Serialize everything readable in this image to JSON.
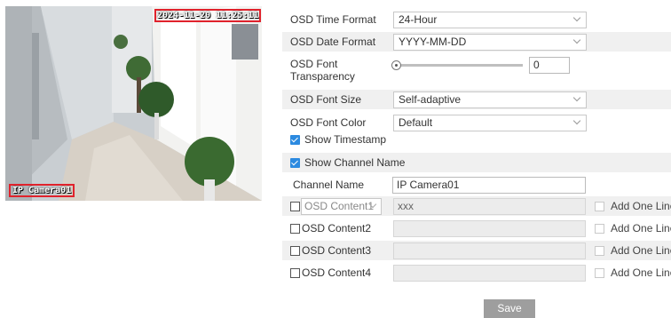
{
  "preview": {
    "osd_time": "2024-11-20 11:25:11",
    "osd_channel_name": "IP Camera01"
  },
  "settings": {
    "time_format_label": "OSD Time Format",
    "time_format_value": "24-Hour",
    "date_format_label": "OSD Date Format",
    "date_format_value": "YYYY-MM-DD",
    "font_transparency_label_line1": "OSD Font",
    "font_transparency_label_line2": "Transparency",
    "font_transparency_value": "0",
    "font_size_label": "OSD Font Size",
    "font_size_value": "Self-adaptive",
    "font_color_label": "OSD Font Color",
    "font_color_value": "Default",
    "show_timestamp_label": "Show Timestamp",
    "show_timestamp_checked": true,
    "show_channel_name_label": "Show Channel Name",
    "show_channel_name_checked": true,
    "channel_name_label": "Channel Name",
    "channel_name_value": "IP Camera01"
  },
  "osd_contents": [
    {
      "label": "OSD Content1",
      "value": "xxx",
      "add_one_line": "Add One Line"
    },
    {
      "label": "OSD Content2",
      "value": "",
      "add_one_line": "Add One Line"
    },
    {
      "label": "OSD Content3",
      "value": "",
      "add_one_line": "Add One Line"
    },
    {
      "label": "OSD Content4",
      "value": "",
      "add_one_line": "Add One Line"
    }
  ],
  "save_label": "Save",
  "colors": {
    "accent": "#2c8ae0",
    "osd_highlight": "#e0222c",
    "save_button": "#9e9e9e",
    "row_shade": "#f0f0f0"
  }
}
